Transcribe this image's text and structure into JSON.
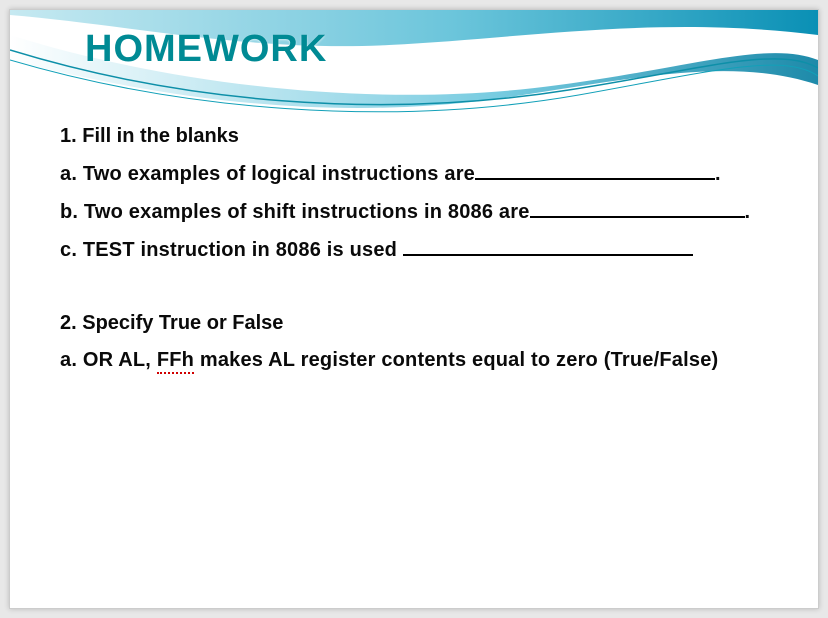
{
  "title": "HOMEWORK",
  "section1": {
    "heading": "1. Fill in the blanks",
    "items": {
      "a": {
        "label": "a. Two examples of logical instructions are"
      },
      "b": {
        "label": "b. Two examples of shift instructions in 8086 are"
      },
      "c": {
        "label": "c. TEST instruction in 8086 is used "
      }
    }
  },
  "section2": {
    "heading": "2. Specify True or False",
    "items": {
      "a": {
        "prefix": "a. OR AL, ",
        "spell": "FFh",
        "suffix": " makes AL register contents equal to zero (True/False)"
      }
    }
  }
}
